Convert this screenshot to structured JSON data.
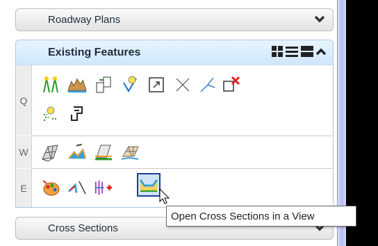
{
  "panels": {
    "roadway": {
      "label": "Roadway Plans",
      "icon": "chevron-down-icon"
    },
    "existing": {
      "label": "Existing Features",
      "icon": "chevron-up-icon"
    },
    "cross": {
      "label": "Cross Sections",
      "icon": "chevron-down-icon"
    }
  },
  "rows": [
    {
      "key": "Q"
    },
    {
      "key": "W"
    },
    {
      "key": "E"
    }
  ],
  "view_icons": [
    "grid-view-icon",
    "list-view-icon",
    "large-view-icon"
  ],
  "tooltip": {
    "text": "Open Cross Sections in a View"
  },
  "colors": {
    "accent": "#1c3f94",
    "header_bg": "#cfe7fb"
  }
}
